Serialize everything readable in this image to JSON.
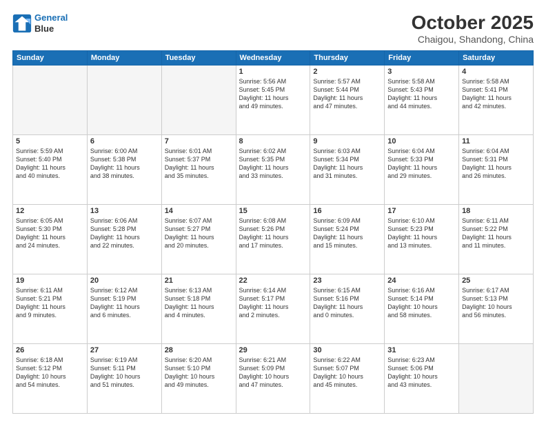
{
  "header": {
    "logo_line1": "General",
    "logo_line2": "Blue",
    "month": "October 2025",
    "location": "Chaigou, Shandong, China"
  },
  "days_of_week": [
    "Sunday",
    "Monday",
    "Tuesday",
    "Wednesday",
    "Thursday",
    "Friday",
    "Saturday"
  ],
  "weeks": [
    [
      {
        "num": "",
        "info": ""
      },
      {
        "num": "",
        "info": ""
      },
      {
        "num": "",
        "info": ""
      },
      {
        "num": "1",
        "info": "Sunrise: 5:56 AM\nSunset: 5:45 PM\nDaylight: 11 hours\nand 49 minutes."
      },
      {
        "num": "2",
        "info": "Sunrise: 5:57 AM\nSunset: 5:44 PM\nDaylight: 11 hours\nand 47 minutes."
      },
      {
        "num": "3",
        "info": "Sunrise: 5:58 AM\nSunset: 5:43 PM\nDaylight: 11 hours\nand 44 minutes."
      },
      {
        "num": "4",
        "info": "Sunrise: 5:58 AM\nSunset: 5:41 PM\nDaylight: 11 hours\nand 42 minutes."
      }
    ],
    [
      {
        "num": "5",
        "info": "Sunrise: 5:59 AM\nSunset: 5:40 PM\nDaylight: 11 hours\nand 40 minutes."
      },
      {
        "num": "6",
        "info": "Sunrise: 6:00 AM\nSunset: 5:38 PM\nDaylight: 11 hours\nand 38 minutes."
      },
      {
        "num": "7",
        "info": "Sunrise: 6:01 AM\nSunset: 5:37 PM\nDaylight: 11 hours\nand 35 minutes."
      },
      {
        "num": "8",
        "info": "Sunrise: 6:02 AM\nSunset: 5:35 PM\nDaylight: 11 hours\nand 33 minutes."
      },
      {
        "num": "9",
        "info": "Sunrise: 6:03 AM\nSunset: 5:34 PM\nDaylight: 11 hours\nand 31 minutes."
      },
      {
        "num": "10",
        "info": "Sunrise: 6:04 AM\nSunset: 5:33 PM\nDaylight: 11 hours\nand 29 minutes."
      },
      {
        "num": "11",
        "info": "Sunrise: 6:04 AM\nSunset: 5:31 PM\nDaylight: 11 hours\nand 26 minutes."
      }
    ],
    [
      {
        "num": "12",
        "info": "Sunrise: 6:05 AM\nSunset: 5:30 PM\nDaylight: 11 hours\nand 24 minutes."
      },
      {
        "num": "13",
        "info": "Sunrise: 6:06 AM\nSunset: 5:28 PM\nDaylight: 11 hours\nand 22 minutes."
      },
      {
        "num": "14",
        "info": "Sunrise: 6:07 AM\nSunset: 5:27 PM\nDaylight: 11 hours\nand 20 minutes."
      },
      {
        "num": "15",
        "info": "Sunrise: 6:08 AM\nSunset: 5:26 PM\nDaylight: 11 hours\nand 17 minutes."
      },
      {
        "num": "16",
        "info": "Sunrise: 6:09 AM\nSunset: 5:24 PM\nDaylight: 11 hours\nand 15 minutes."
      },
      {
        "num": "17",
        "info": "Sunrise: 6:10 AM\nSunset: 5:23 PM\nDaylight: 11 hours\nand 13 minutes."
      },
      {
        "num": "18",
        "info": "Sunrise: 6:11 AM\nSunset: 5:22 PM\nDaylight: 11 hours\nand 11 minutes."
      }
    ],
    [
      {
        "num": "19",
        "info": "Sunrise: 6:11 AM\nSunset: 5:21 PM\nDaylight: 11 hours\nand 9 minutes."
      },
      {
        "num": "20",
        "info": "Sunrise: 6:12 AM\nSunset: 5:19 PM\nDaylight: 11 hours\nand 6 minutes."
      },
      {
        "num": "21",
        "info": "Sunrise: 6:13 AM\nSunset: 5:18 PM\nDaylight: 11 hours\nand 4 minutes."
      },
      {
        "num": "22",
        "info": "Sunrise: 6:14 AM\nSunset: 5:17 PM\nDaylight: 11 hours\nand 2 minutes."
      },
      {
        "num": "23",
        "info": "Sunrise: 6:15 AM\nSunset: 5:16 PM\nDaylight: 11 hours\nand 0 minutes."
      },
      {
        "num": "24",
        "info": "Sunrise: 6:16 AM\nSunset: 5:14 PM\nDaylight: 10 hours\nand 58 minutes."
      },
      {
        "num": "25",
        "info": "Sunrise: 6:17 AM\nSunset: 5:13 PM\nDaylight: 10 hours\nand 56 minutes."
      }
    ],
    [
      {
        "num": "26",
        "info": "Sunrise: 6:18 AM\nSunset: 5:12 PM\nDaylight: 10 hours\nand 54 minutes."
      },
      {
        "num": "27",
        "info": "Sunrise: 6:19 AM\nSunset: 5:11 PM\nDaylight: 10 hours\nand 51 minutes."
      },
      {
        "num": "28",
        "info": "Sunrise: 6:20 AM\nSunset: 5:10 PM\nDaylight: 10 hours\nand 49 minutes."
      },
      {
        "num": "29",
        "info": "Sunrise: 6:21 AM\nSunset: 5:09 PM\nDaylight: 10 hours\nand 47 minutes."
      },
      {
        "num": "30",
        "info": "Sunrise: 6:22 AM\nSunset: 5:07 PM\nDaylight: 10 hours\nand 45 minutes."
      },
      {
        "num": "31",
        "info": "Sunrise: 6:23 AM\nSunset: 5:06 PM\nDaylight: 10 hours\nand 43 minutes."
      },
      {
        "num": "",
        "info": ""
      }
    ]
  ]
}
